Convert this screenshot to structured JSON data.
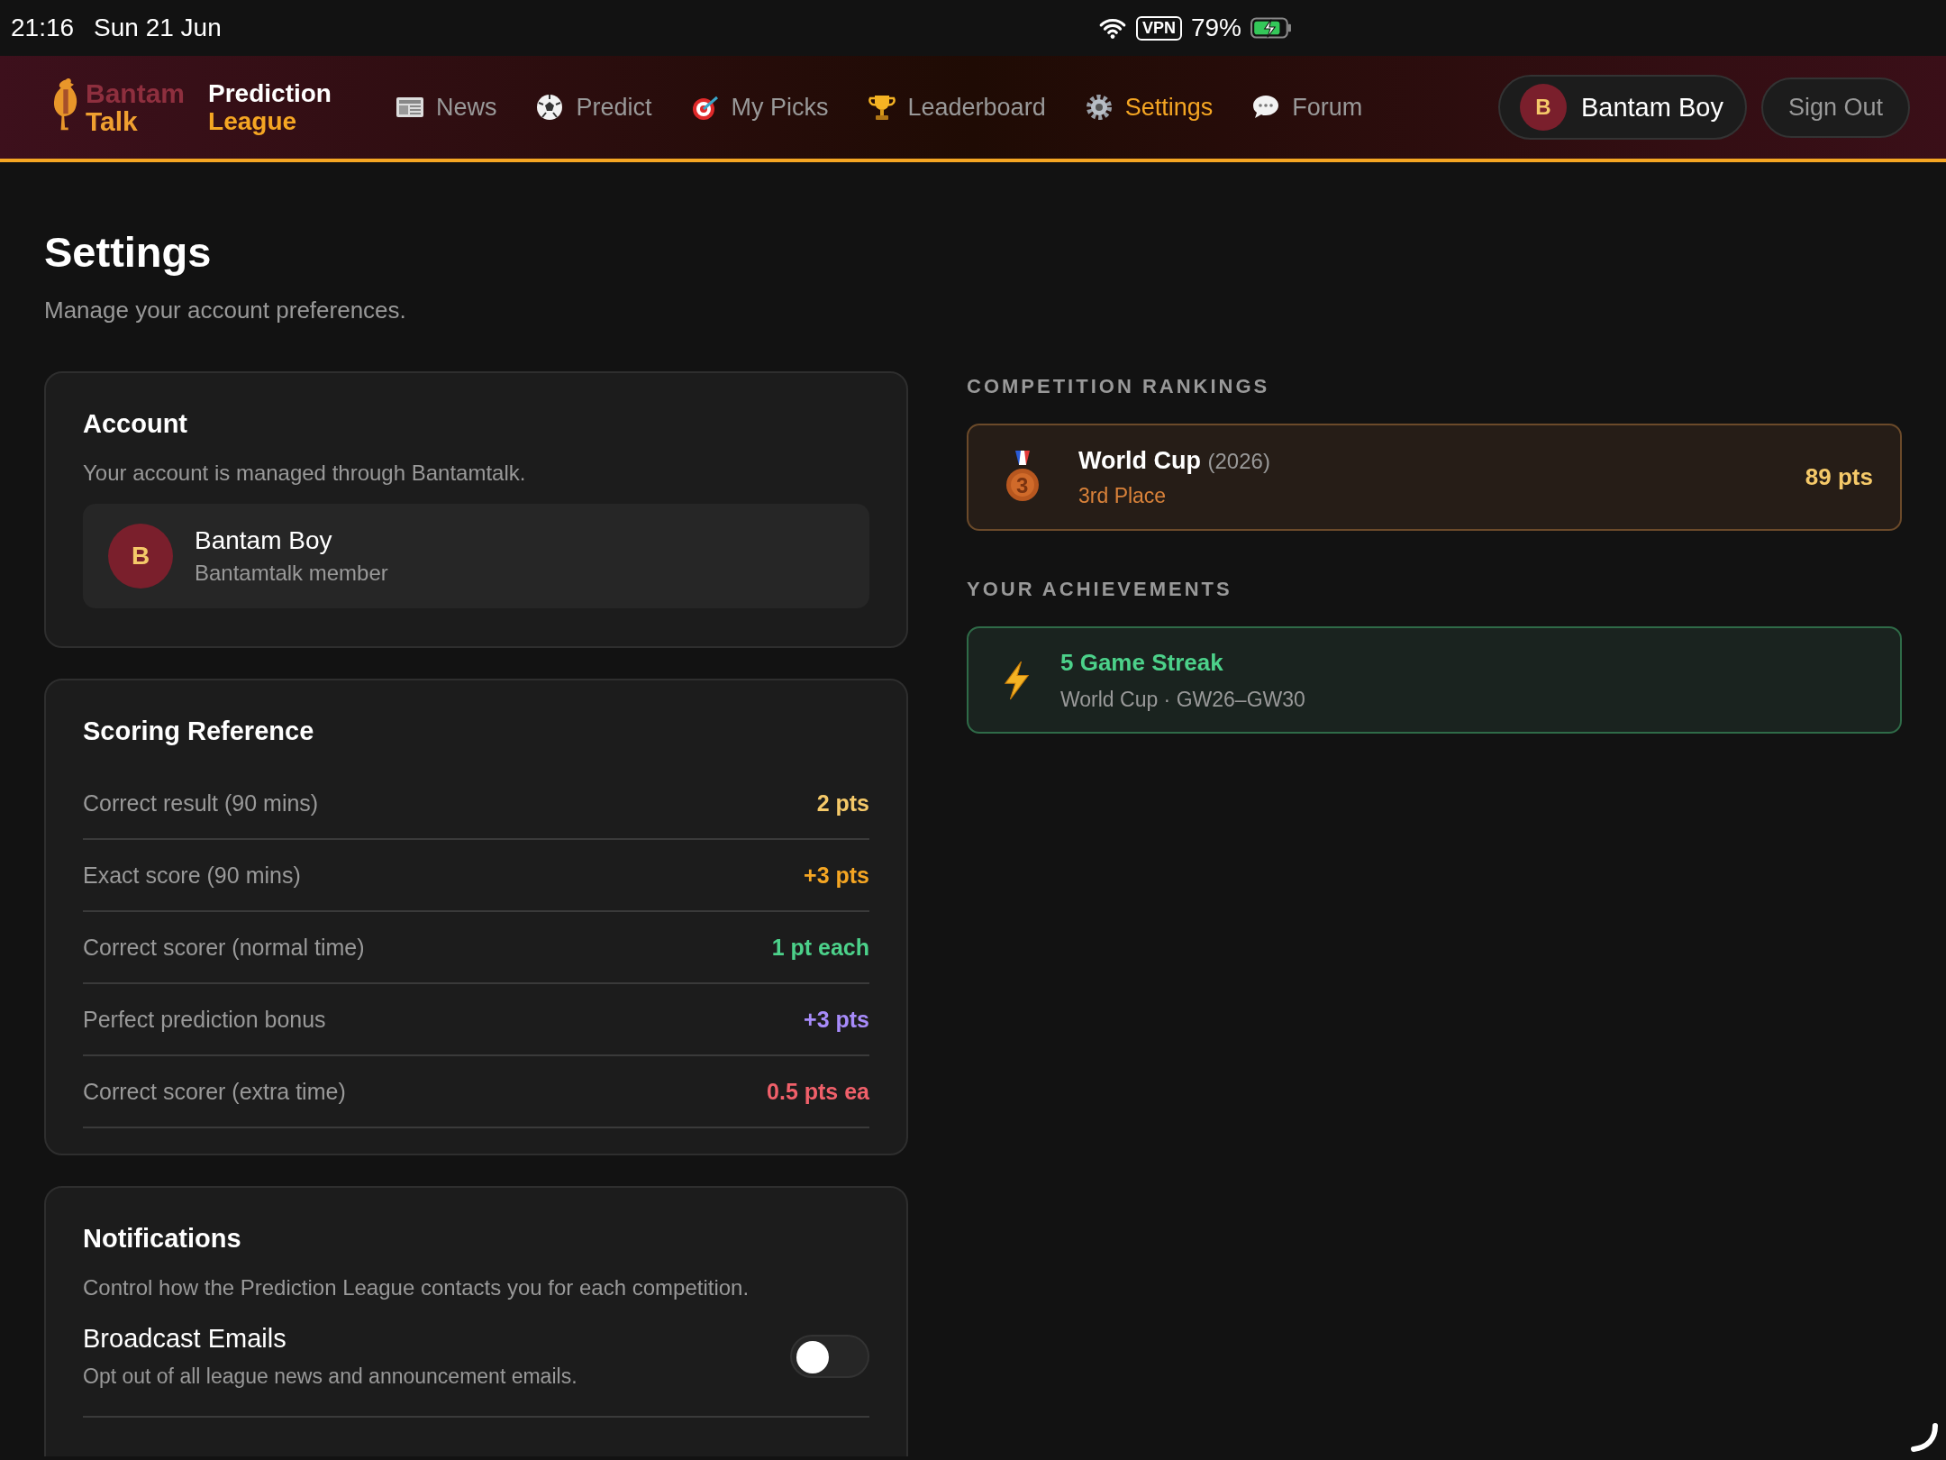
{
  "status_bar": {
    "time": "21:16",
    "date": "Sun 21 Jun",
    "vpn": "VPN",
    "battery": "79%"
  },
  "header": {
    "logo_top": "Bantam",
    "logo_bottom": "Talk",
    "title_top": "Prediction",
    "title_bottom": "League",
    "nav": [
      {
        "label": "News",
        "selected": false
      },
      {
        "label": "Predict",
        "selected": false
      },
      {
        "label": "My Picks",
        "selected": false
      },
      {
        "label": "Leaderboard",
        "selected": false
      },
      {
        "label": "Settings",
        "selected": true
      },
      {
        "label": "Forum",
        "selected": false
      }
    ],
    "user": {
      "initial": "B",
      "name": "Bantam Boy"
    },
    "sign_out": "Sign Out"
  },
  "page": {
    "title": "Settings",
    "subtitle": "Manage your account preferences."
  },
  "account": {
    "title": "Account",
    "description": "Your account is managed through Bantamtalk.",
    "initial": "B",
    "name": "Bantam Boy",
    "role": "Bantamtalk member"
  },
  "scoring": {
    "title": "Scoring Reference",
    "rows": [
      {
        "label": "Correct result (90 mins)",
        "value": "2 pts",
        "color": "#f5c969"
      },
      {
        "label": "Exact score (90 mins)",
        "value": "+3 pts",
        "color": "#f5a623"
      },
      {
        "label": "Correct scorer (normal time)",
        "value": "1 pt each",
        "color": "#4cd18a"
      },
      {
        "label": "Perfect prediction bonus",
        "value": "+3 pts",
        "color": "#a78bfa"
      },
      {
        "label": "Correct scorer (extra time)",
        "value": "0.5 pts ea",
        "color": "#f0606a"
      }
    ]
  },
  "notifications": {
    "title": "Notifications",
    "description": "Control how the Prediction League contacts you for each competition.",
    "settings": [
      {
        "label": "Broadcast Emails",
        "description": "Opt out of all league news and announcement emails.",
        "on": false
      }
    ]
  },
  "rankings": {
    "heading": "COMPETITION RANKINGS",
    "items": [
      {
        "name": "World Cup",
        "year": "(2026)",
        "place": "3rd Place",
        "medal": "3",
        "points": "89 pts"
      }
    ]
  },
  "achievements": {
    "heading": "YOUR ACHIEVEMENTS",
    "items": [
      {
        "title": "5 Game Streak",
        "detail": "World Cup · GW26–GW30"
      }
    ]
  }
}
